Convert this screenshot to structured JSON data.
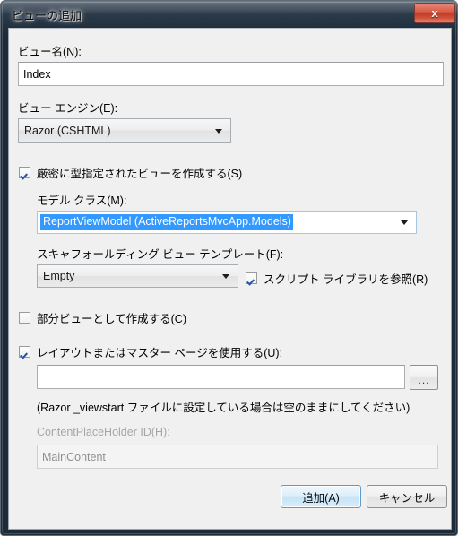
{
  "window": {
    "title": "ビューの追加",
    "close_glyph": "x"
  },
  "form": {
    "view_name_label": "ビュー名(N):",
    "view_name_value": "Index",
    "view_engine_label": "ビュー エンジン(E):",
    "view_engine_value": "Razor (CSHTML)",
    "strongly_typed_label": "厳密に型指定されたビューを作成する(S)",
    "model_class_label": "モデル クラス(M):",
    "model_class_value": "ReportViewModel (ActiveReportsMvcApp.Models)",
    "scaffold_template_label": "スキャフォールディング ビュー テンプレート(F):",
    "scaffold_template_value": "Empty",
    "script_library_label": "スクリプト ライブラリを参照(R)",
    "partial_view_label": "部分ビューとして作成する(C)",
    "layout_page_label": "レイアウトまたはマスター ページを使用する(U):",
    "layout_page_value": "",
    "browse_button_label": "...",
    "layout_hint": "(Razor _viewstart ファイルに設定している場合は空のままにしてください)",
    "content_placeholder_label": "ContentPlaceHolder ID(H):",
    "content_placeholder_value": "MainContent"
  },
  "buttons": {
    "add_label": "追加(A)",
    "cancel_label": "キャンセル"
  },
  "colors": {
    "selection_blue": "#3399ff",
    "close_red": "#c03a26",
    "dialog_background": "#f0f0f0",
    "default_button_blue": "#5c9ccc"
  }
}
